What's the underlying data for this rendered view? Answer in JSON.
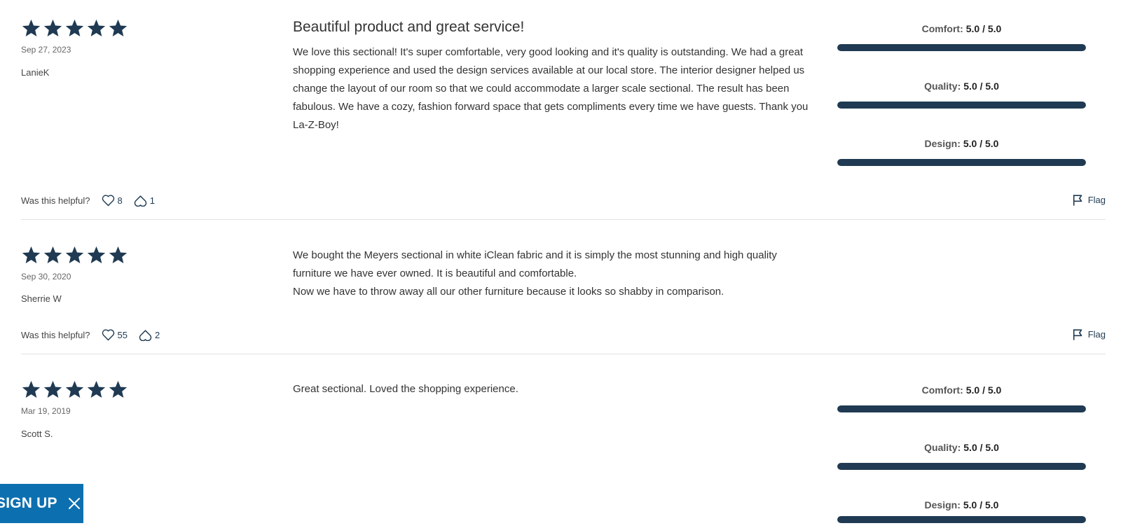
{
  "colors": {
    "star": "#1f3a52",
    "bar_fill": "#1f3a52",
    "signup_bg": "#0c70b0"
  },
  "helpful_label": "Was this helpful?",
  "flag_label": "Flag",
  "signup": {
    "label": "SIGN UP",
    "close_icon": "close-icon"
  },
  "reviews": [
    {
      "stars": 5,
      "date": "Sep 27, 2023",
      "author": "LanieK",
      "title": "Beautiful product and great service!",
      "body": "We love this sectional! It's super comfortable, very good looking and it's quality is outstanding. We had a great shopping experience and used the design services available at our local store. The interior designer helped us change the layout of our room so that we could accommodate a larger scale sectional. The result has been fabulous. We have a cozy, fashion forward space that gets compliments every time we have guests. Thank you La-Z-Boy!",
      "ratings": [
        {
          "name": "Comfort:",
          "value": "5.0 / 5.0",
          "fraction": 1.0
        },
        {
          "name": "Quality:",
          "value": "5.0 / 5.0",
          "fraction": 1.0
        },
        {
          "name": "Design:",
          "value": "5.0 / 5.0",
          "fraction": 1.0
        }
      ],
      "helpful_count": "8",
      "unhelpful_count": "1"
    },
    {
      "stars": 5,
      "date": "Sep 30, 2020",
      "author": "Sherrie W",
      "body_line1": "We bought the Meyers sectional in white iClean fabric and it is simply the most stunning and high quality furniture we have ever owned. It is beautiful and comfortable.",
      "body_line2": "Now we have to throw away all our other furniture because it looks so shabby in comparison.",
      "helpful_count": "55",
      "unhelpful_count": "2"
    },
    {
      "stars": 5,
      "date": "Mar 19, 2019",
      "author": "Scott S.",
      "body": "Great sectional. Loved the shopping experience.",
      "ratings": [
        {
          "name": "Comfort:",
          "value": "5.0 / 5.0",
          "fraction": 1.0
        },
        {
          "name": "Quality:",
          "value": "5.0 / 5.0",
          "fraction": 1.0
        },
        {
          "name": "Design:",
          "value": "5.0 / 5.0",
          "fraction": 1.0
        }
      ]
    }
  ]
}
